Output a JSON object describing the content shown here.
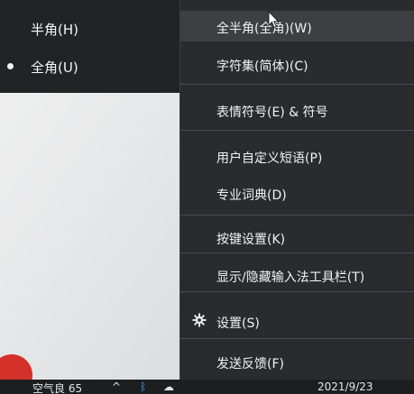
{
  "submenu": {
    "items": [
      {
        "label": "半角(H)",
        "selected": false
      },
      {
        "label": "全角(U)",
        "selected": true
      }
    ]
  },
  "context_menu": {
    "items": [
      {
        "label": "全半角(全角)(W)",
        "highlighted": true
      },
      {
        "label": "字符集(简体)(C)"
      },
      {
        "label": "表情符号(E) & 符号"
      },
      {
        "label": "用户自定义短语(P)"
      },
      {
        "label": "专业词典(D)"
      },
      {
        "label": "按键设置(K)"
      },
      {
        "label": "显示/隐藏输入法工具栏(T)"
      },
      {
        "label": "设置(S)",
        "icon": "gear-icon"
      },
      {
        "label": "发送反馈(F)"
      }
    ]
  },
  "taskbar": {
    "left_text": "空气良 65",
    "date": "2021/9/23"
  },
  "colors": {
    "menu_bg": "#2a2b2d",
    "submenu_bg": "#222325",
    "highlight": "#3e3f42",
    "text": "#f2f2f2"
  }
}
